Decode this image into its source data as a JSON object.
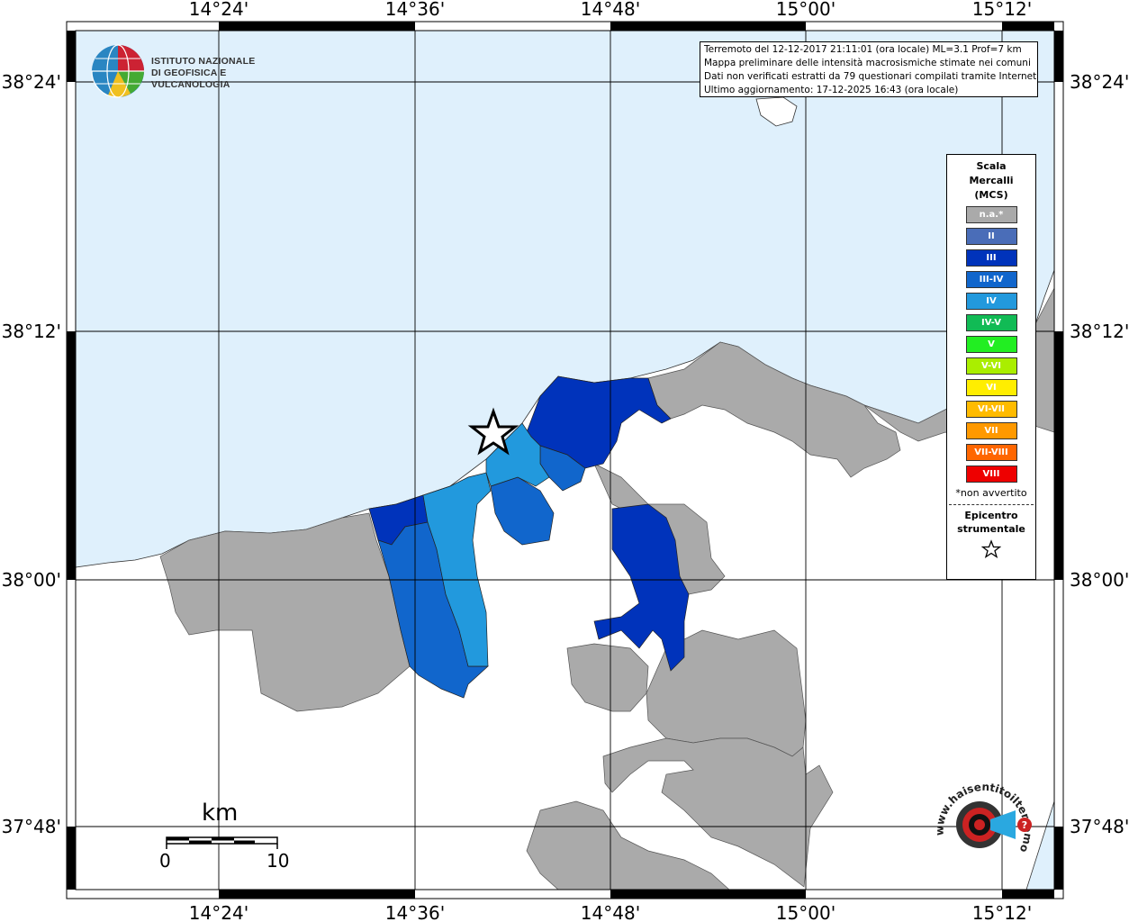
{
  "map": {
    "lon_ticks": [
      "14°24'",
      "14°36'",
      "14°48'",
      "15°00'",
      "15°12'"
    ],
    "lat_ticks": [
      "38°24'",
      "38°12'",
      "38°00'",
      "37°48'"
    ],
    "colors": {
      "sea": "#dff0fc",
      "land_na": "#aaaaaa",
      "land_outside": "#ffffff",
      "grid": "#000000"
    }
  },
  "institution": {
    "line1": "ISTITUTO NAZIONALE",
    "line2": "DI GEOFISICA E VULCANOLOGIA"
  },
  "info": {
    "line1": "Terremoto del 12-12-2017 21:11:01 (ora locale) ML=3.1 Prof=7 km",
    "line2": "Mappa preliminare delle intensità macrosismiche stimate nei comuni",
    "line3": "Dati non verificati estratti da 79 questionari compilati tramite Internet.",
    "line4": "Ultimo aggiornamento: 17-12-2025 16:43 (ora locale)"
  },
  "legend": {
    "title_line1": "Scala",
    "title_line2": "Mercalli",
    "title_line3": "(MCS)",
    "items": [
      {
        "label": "n.a.*",
        "color": "#aaaaaa"
      },
      {
        "label": "II",
        "color": "#4a6db8"
      },
      {
        "label": "III",
        "color": "#0033bb"
      },
      {
        "label": "III-IV",
        "color": "#1166cc"
      },
      {
        "label": "IV",
        "color": "#2299dd"
      },
      {
        "label": "IV-V",
        "color": "#11bb55"
      },
      {
        "label": "V",
        "color": "#22ee22"
      },
      {
        "label": "V-VI",
        "color": "#aaee00"
      },
      {
        "label": "VI",
        "color": "#ffee00"
      },
      {
        "label": "VI-VII",
        "color": "#ffbb00"
      },
      {
        "label": "VII",
        "color": "#ff9900"
      },
      {
        "label": "VII-VIII",
        "color": "#ff6600"
      },
      {
        "label": "VIII",
        "color": "#ee0000"
      }
    ],
    "note": "*non avvertito",
    "epicenter_line1": "Epicentro",
    "epicenter_line2": "strumentale",
    "star_symbol": "☆"
  },
  "scale_bar": {
    "unit": "km",
    "min_label": "0",
    "max_label": "10"
  },
  "badge": {
    "text": "www.haisentitoilterremoto.it"
  }
}
